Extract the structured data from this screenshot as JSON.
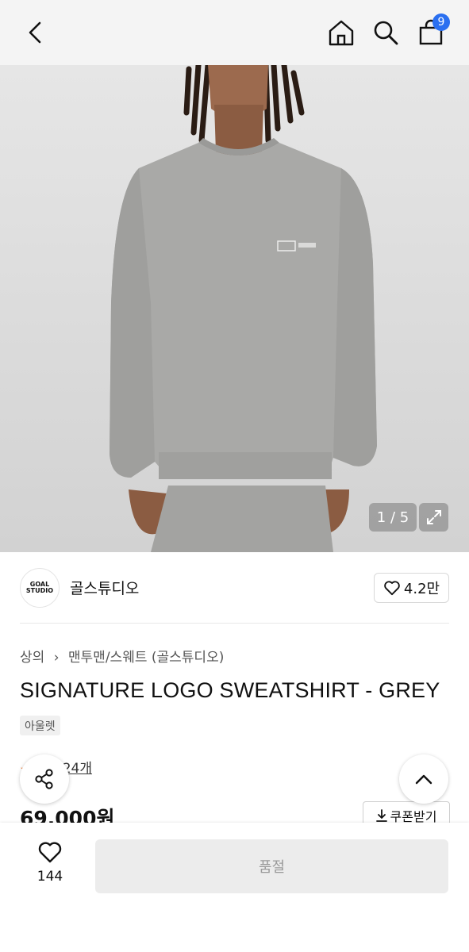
{
  "header": {
    "cart_count": "9"
  },
  "hero": {
    "counter": "1 / 5"
  },
  "brand": {
    "logo_text_1": "GOAL",
    "logo_text_2": "STUDIO",
    "name": "골스튜디오",
    "likes": "4.2만"
  },
  "product": {
    "breadcrumb": [
      "상의",
      "맨투맨/스웨트 (골스튜디오)"
    ],
    "title": "SIGNATURE LOGO SWEATSHIRT - GREY",
    "tag": "아울렛",
    "review_prefix": "★ ",
    "review_link": "후기 24개",
    "price": "69,000원",
    "coupon": "쿠폰받기"
  },
  "bottom": {
    "wish_count": "144",
    "cta": "품절"
  },
  "colors": {
    "accent": "#2a6ff0",
    "review_star": "#f07a30",
    "disabled": "#ececec"
  }
}
